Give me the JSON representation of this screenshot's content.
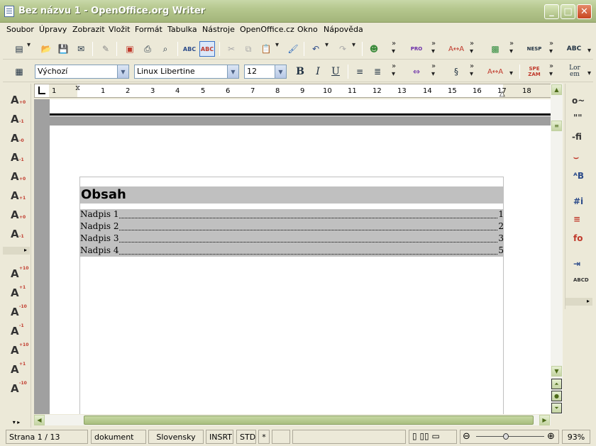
{
  "window": {
    "title": "Bez názvu 1 - OpenOffice.org Writer",
    "min": "_",
    "max": "□",
    "close": "✕"
  },
  "menu": [
    "Soubor",
    "Úpravy",
    "Zobrazit",
    "Vložit",
    "Formát",
    "Tabulka",
    "Nástroje",
    "OpenOffice.cz",
    "Okno",
    "Nápověda"
  ],
  "toolbar1": {
    "icons": [
      "new-document-icon",
      "open-icon",
      "save-icon",
      "email-icon",
      "edit-mode-icon",
      "export-pdf-icon",
      "print-icon",
      "print-preview-icon",
      "spellcheck-icon",
      "autospellcheck-icon",
      "cut-icon",
      "copy-icon",
      "paste-icon",
      "format-paintbrush-icon",
      "undo-icon",
      "redo-icon",
      "navigator-icon",
      "promo-icon",
      "translit-icon",
      "gallery-icon",
      "hyphenation-icon",
      "spellcheck2-icon"
    ],
    "labels": {
      "pro": "PRO",
      "nesp": "NESP",
      "abc": "ABC"
    }
  },
  "toolbar2": {
    "style": "Výchozí",
    "font": "Linux Libertine",
    "size": "12",
    "bold": "B",
    "italic": "I",
    "underline": "U",
    "spe": "SPE\nZAM",
    "lor": "Lor\nem"
  },
  "ruler": [
    "1",
    "1",
    "2",
    "3",
    "4",
    "5",
    "6",
    "7",
    "8",
    "9",
    "10",
    "11",
    "12",
    "13",
    "14",
    "15",
    "16",
    "17",
    "18"
  ],
  "leftbar": {
    "group1": [
      "+0",
      "-1",
      "-0",
      "-1",
      "+0",
      "+1",
      "+0",
      "-1"
    ],
    "group2": [
      "+10",
      "+1",
      "-10",
      "-1",
      "+10",
      "+1",
      "-10"
    ]
  },
  "rightbar": [
    "o~",
    "\"\"",
    "-fi",
    "⌣",
    "ᴬB",
    "#i",
    "≡",
    "fo",
    "⇥",
    "ABCD"
  ],
  "document": {
    "toc_title": "Obsah",
    "entries": [
      {
        "label": "Nadpis 1",
        "page": "1"
      },
      {
        "label": "Nadpis 2",
        "page": "2"
      },
      {
        "label": "Nadpis 3",
        "page": "3"
      },
      {
        "label": "Nadpis 4",
        "page": "5"
      }
    ]
  },
  "status": {
    "page": "Strana 1 / 13",
    "style": "dokument",
    "language": "Slovensky",
    "insert": "INSRT",
    "selection": "STD",
    "modified": "*",
    "zoom": "93%"
  }
}
